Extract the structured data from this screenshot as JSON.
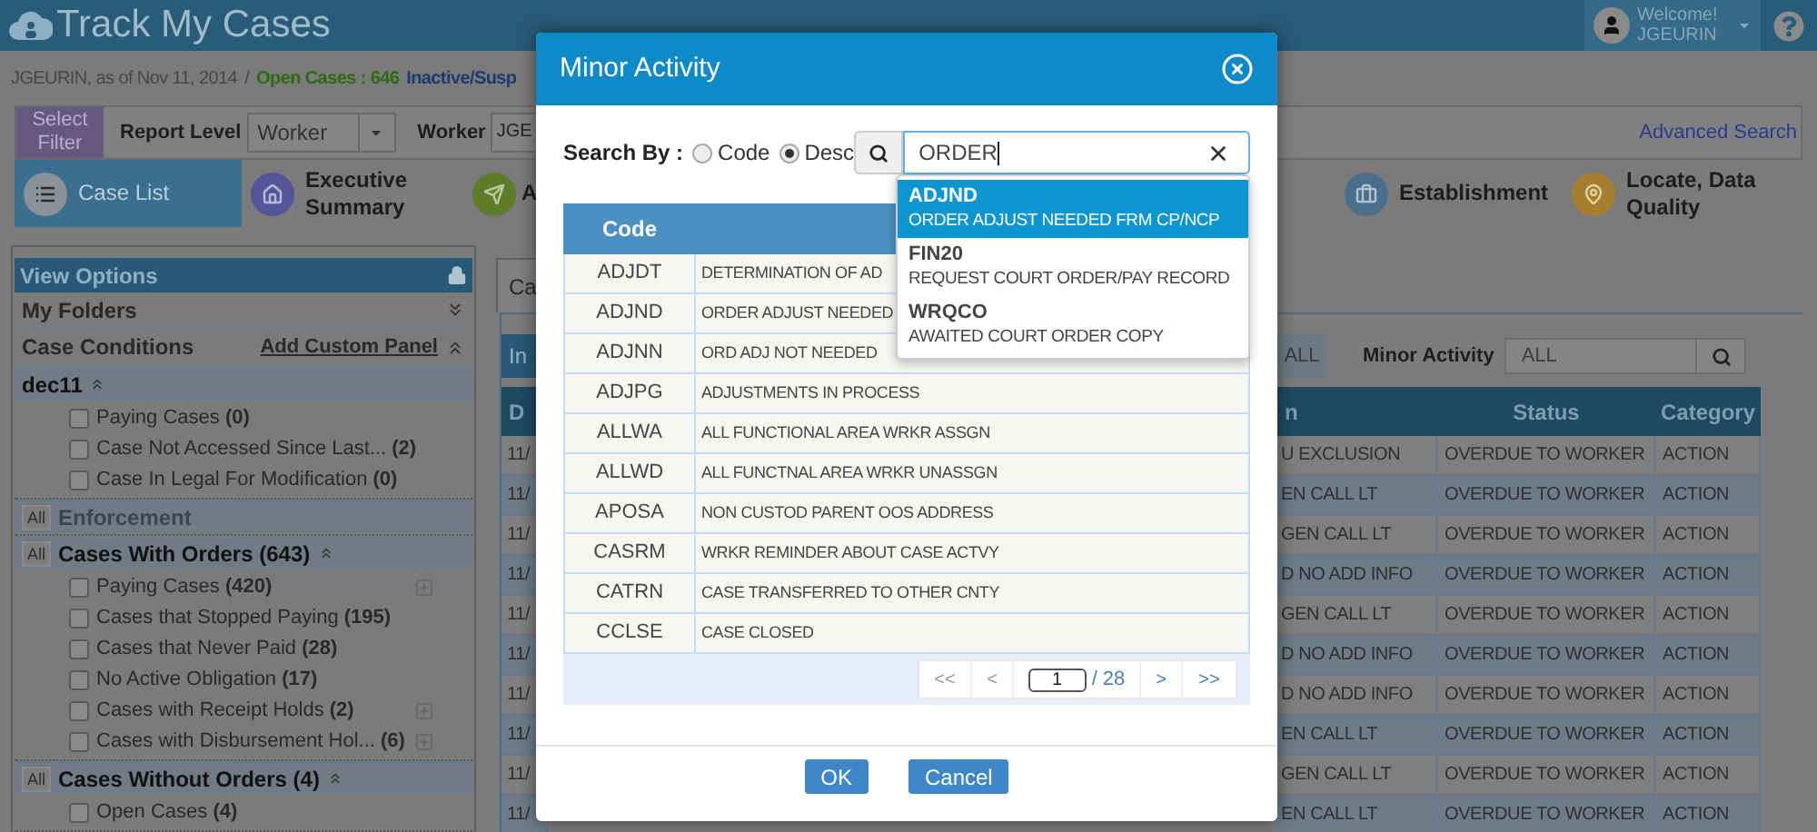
{
  "header": {
    "title": "Track My Cases",
    "greeting": "Welcome!",
    "user": "JGEURIN"
  },
  "info_bar": {
    "user_date": "JGEURIN, as of Nov 11, 2014",
    "separator": "/",
    "open_cases": "Open Cases : 646",
    "inactive": "Inactive/Susp"
  },
  "filter_bar": {
    "select_filter": "Select Filter",
    "report_level_label": "Report Level",
    "report_level_value": "Worker",
    "worker_label": "Worker",
    "worker_value": "JGE",
    "advanced_search": "Advanced Search"
  },
  "nav": [
    {
      "label": "Case List",
      "selected": true,
      "kind": "list",
      "color": "#8a9298"
    },
    {
      "label": "Executive Summary",
      "selected": false,
      "kind": "home",
      "color": "#55559a"
    },
    {
      "label": "A",
      "selected": false,
      "kind": "send",
      "color": "#5d7d2a"
    },
    {
      "label": "Establishment",
      "selected": false,
      "kind": "briefcase",
      "color": "#4a6f8c"
    },
    {
      "label": "Locate, Data Quality",
      "selected": false,
      "kind": "pin",
      "color": "#a57e2e"
    }
  ],
  "sidebar": {
    "title": "View Options",
    "my_folders": {
      "label": "My Folders",
      "expanded": false
    },
    "case_conditions": {
      "label": "Case Conditions",
      "action": "Add Custom Panel",
      "expanded": true
    },
    "groups": [
      {
        "name": "dec11",
        "expanded": true,
        "disabled": false,
        "items": [
          {
            "label": "Paying Cases **(0)**",
            "checked": false,
            "expandable": false
          },
          {
            "label": "Case Not Accessed Since Last... **(2)**",
            "checked": false,
            "expandable": false
          },
          {
            "label": "Case In Legal For Modification **(0)**",
            "checked": false,
            "expandable": false
          }
        ]
      },
      {
        "all_button": "All",
        "name": "Enforcement",
        "expanded": false,
        "disabled": true
      },
      {
        "all_button": "All",
        "name": "Cases With Orders (643)",
        "expanded": true,
        "disabled": false,
        "items": [
          {
            "label": "Paying Cases **(420)**",
            "checked": false,
            "expandable": true
          },
          {
            "label": "Cases that Stopped Paying **(195)**",
            "checked": false,
            "expandable": false
          },
          {
            "label": "Cases that Never Paid **(28)**",
            "checked": false,
            "expandable": false
          },
          {
            "label": "No Active Obligation **(17)**",
            "checked": false,
            "expandable": false
          },
          {
            "label": "Cases with Receipt Holds **(2)**",
            "checked": false,
            "expandable": true
          },
          {
            "label": "Cases with Disbursement Hol... **(6)**",
            "checked": false,
            "expandable": true
          }
        ]
      },
      {
        "all_button": "All",
        "name": "Cases Without Orders (4)",
        "expanded": true,
        "disabled": false,
        "items": [
          {
            "label": "Open Cases **(4)**",
            "checked": false,
            "expandable": false
          }
        ]
      }
    ]
  },
  "content": {
    "tab": "Ca",
    "panel_title": "In",
    "all_button": "ALL",
    "minor_activity": {
      "label": "Minor Activity",
      "value": "ALL"
    },
    "table": {
      "columns": [
        "D",
        "n",
        "Status",
        "Category"
      ],
      "rows": [
        {
          "date": "11/",
          "description": "U EXCLUSION",
          "status": "OVERDUE TO WORKER",
          "category": "ACTION"
        },
        {
          "date": "11/",
          "description": "EN CALL LT",
          "status": "OVERDUE TO WORKER",
          "category": "ACTION"
        },
        {
          "date": "11/",
          "description": "GEN CALL LT",
          "status": "OVERDUE TO WORKER",
          "category": "ACTION"
        },
        {
          "date": "11/",
          "description": "D NO ADD INFO",
          "status": "OVERDUE TO WORKER",
          "category": "ACTION"
        },
        {
          "date": "11/",
          "description": "GEN CALL LT",
          "status": "OVERDUE TO WORKER",
          "category": "ACTION"
        },
        {
          "date": "11/",
          "description": "D NO ADD INFO",
          "status": "OVERDUE TO WORKER",
          "category": "ACTION"
        },
        {
          "date": "11/",
          "description": "D NO ADD INFO",
          "status": "OVERDUE TO WORKER",
          "category": "ACTION"
        },
        {
          "date": "11/",
          "description": "EN CALL LT",
          "status": "OVERDUE TO WORKER",
          "category": "ACTION"
        },
        {
          "date": "11/",
          "description": "GEN CALL LT",
          "status": "OVERDUE TO WORKER",
          "category": "ACTION"
        },
        {
          "date": "11/",
          "description": "EN CALL LT",
          "status": "OVERDUE TO WORKER",
          "category": "ACTION"
        }
      ]
    }
  },
  "dialog": {
    "title": "Minor Activity",
    "search_by_label": "Search By :",
    "options": [
      {
        "label": "Code",
        "selected": false
      },
      {
        "label": "Desc",
        "selected": true
      }
    ],
    "search_value": "ORDER",
    "suggestions": [
      {
        "code": "ADJND",
        "desc": "ORDER ADJUST NEEDED FRM CP/NCP",
        "selected": true
      },
      {
        "code": "FIN20",
        "desc": "REQUEST COURT ORDER/PAY RECORD",
        "selected": false
      },
      {
        "code": "WRQCO",
        "desc": "AWAITED COURT ORDER COPY",
        "selected": false
      }
    ],
    "table": {
      "columns": [
        "Code"
      ],
      "rows": [
        {
          "code": "ADJDT",
          "desc": "DETERMINATION OF AD"
        },
        {
          "code": "ADJND",
          "desc": "ORDER ADJUST NEEDED"
        },
        {
          "code": "ADJNN",
          "desc": "ORD ADJ NOT NEEDED"
        },
        {
          "code": "ADJPG",
          "desc": "ADJUSTMENTS IN PROCESS"
        },
        {
          "code": "ALLWA",
          "desc": "ALL FUNCTIONAL AREA WRKR ASSGN"
        },
        {
          "code": "ALLWD",
          "desc": "ALL FUNCTNAL AREA WRKR UNASSGN"
        },
        {
          "code": "APOSA",
          "desc": "NON CUSTOD PARENT OOS ADDRESS"
        },
        {
          "code": "CASRM",
          "desc": "WRKR REMINDER ABOUT CASE ACTVY"
        },
        {
          "code": "CATRN",
          "desc": "CASE TRANSFERRED TO OTHER CNTY"
        },
        {
          "code": "CCLSE",
          "desc": "CASE CLOSED"
        }
      ]
    },
    "pagination": {
      "first": "<<",
      "prev": "<",
      "page": "1",
      "total": "/ 28",
      "next": ">",
      "last": ">>"
    },
    "buttons": [
      "OK",
      "Cancel"
    ]
  }
}
